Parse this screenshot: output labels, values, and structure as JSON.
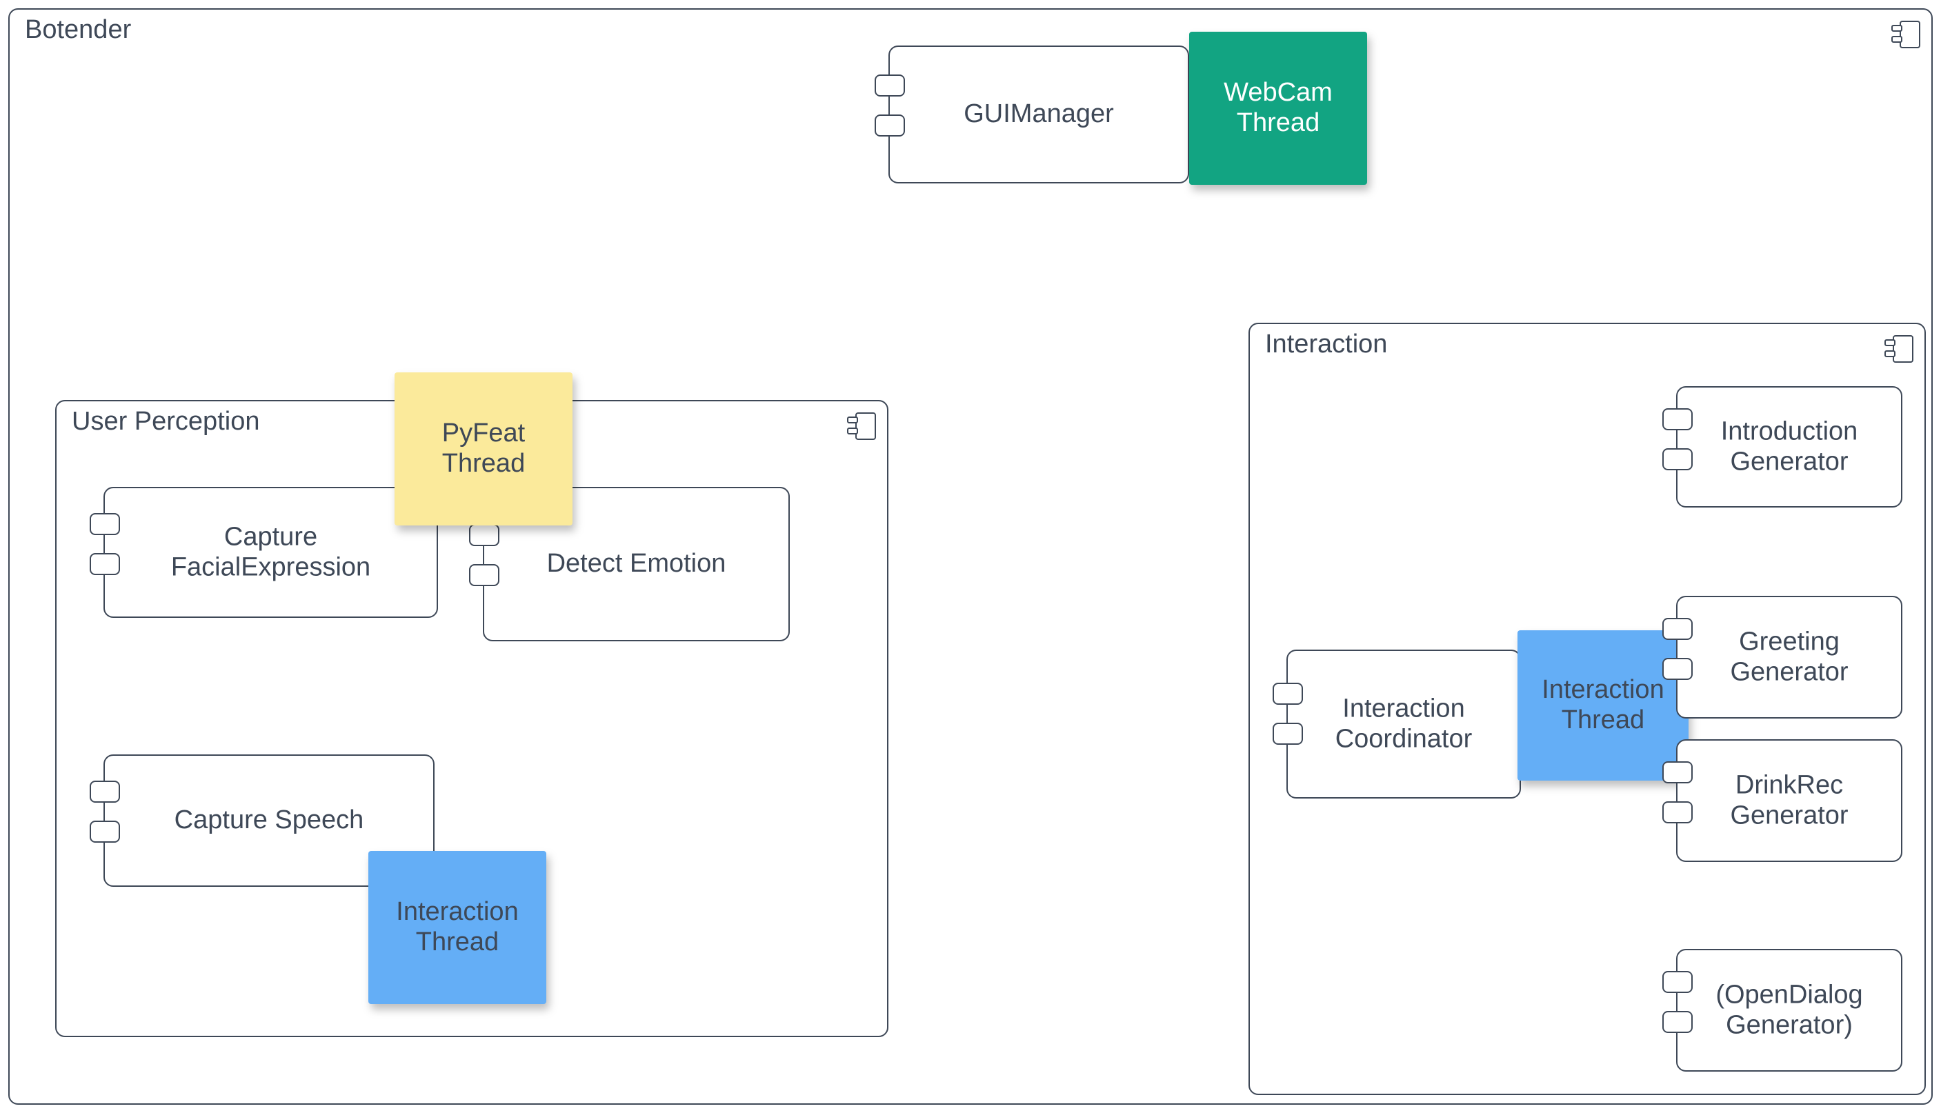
{
  "system": {
    "name": "Botender"
  },
  "gui": {
    "component": "GUIManager",
    "thread_note": "WebCam\nThread"
  },
  "user_perception": {
    "name": "User Perception",
    "capture_face": "Capture\nFacialExpression",
    "detect_emotion": "Detect Emotion",
    "capture_speech": "Capture Speech",
    "pyfeat_note": "PyFeat\nThread",
    "interaction_note": "Interaction\nThread"
  },
  "interaction": {
    "name": "Interaction",
    "coordinator": "Interaction\nCoordinator",
    "thread_note": "Interaction\nThread",
    "generators": {
      "intro": "Introduction\nGenerator",
      "greeting": "Greeting\nGenerator",
      "drinkrec": "DrinkRec\nGenerator",
      "opendialog": "(OpenDialog\nGenerator)"
    }
  }
}
